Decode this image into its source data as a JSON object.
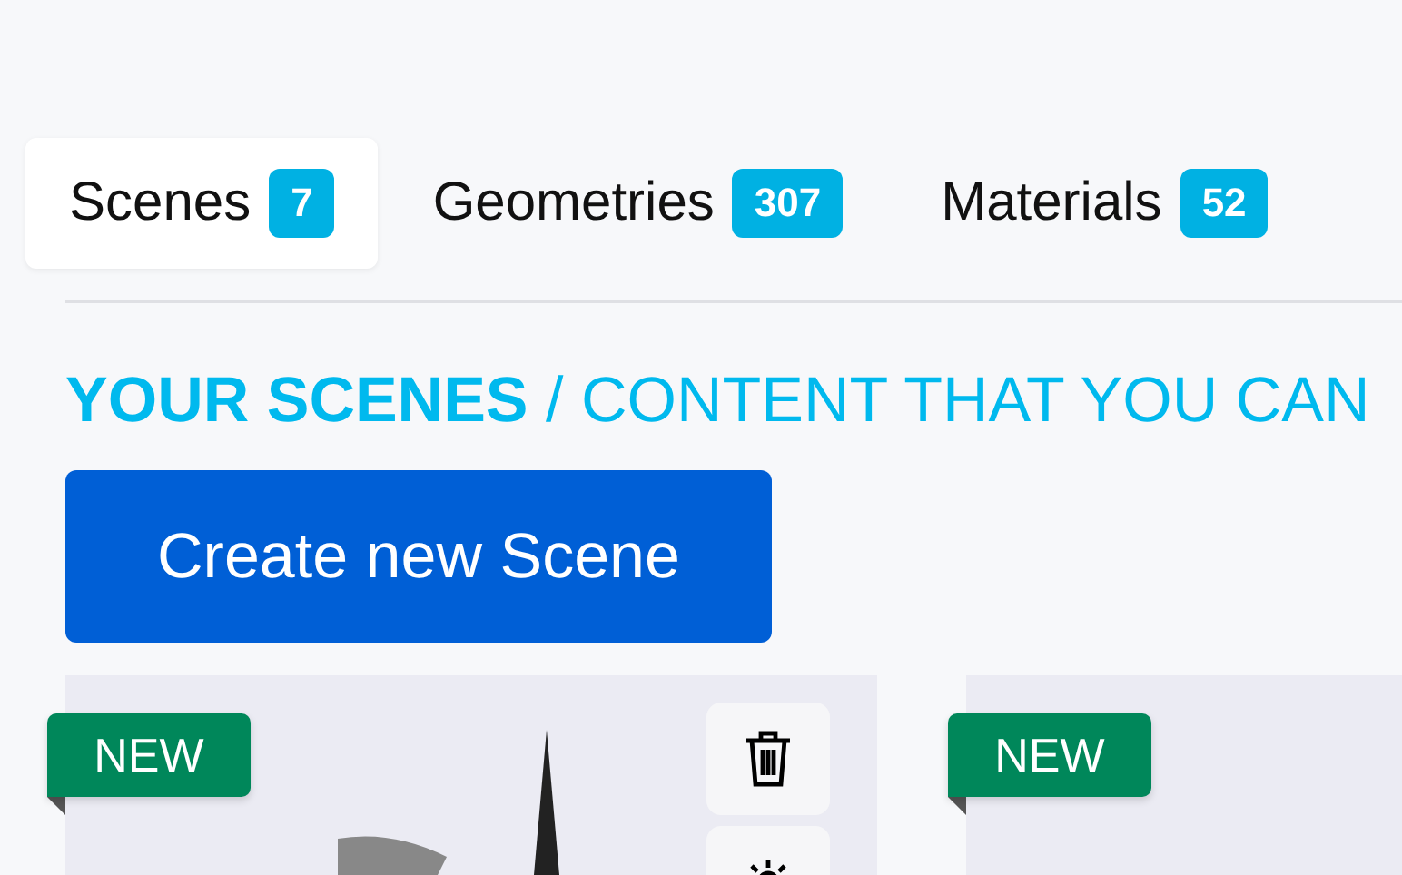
{
  "tabs": [
    {
      "label": "Scenes",
      "count": "7",
      "selected": true
    },
    {
      "label": "Geometries",
      "count": "307",
      "selected": false
    },
    {
      "label": "Materials",
      "count": "52",
      "selected": false
    }
  ],
  "heading": "**YOUR SCENES** / CONTENT THAT YOU CAN",
  "create_button": "Create new Scene",
  "cards": [
    {
      "badge": "NEW",
      "kind": "hovered"
    },
    {
      "badge": "NEW",
      "kind": "plain"
    }
  ]
}
